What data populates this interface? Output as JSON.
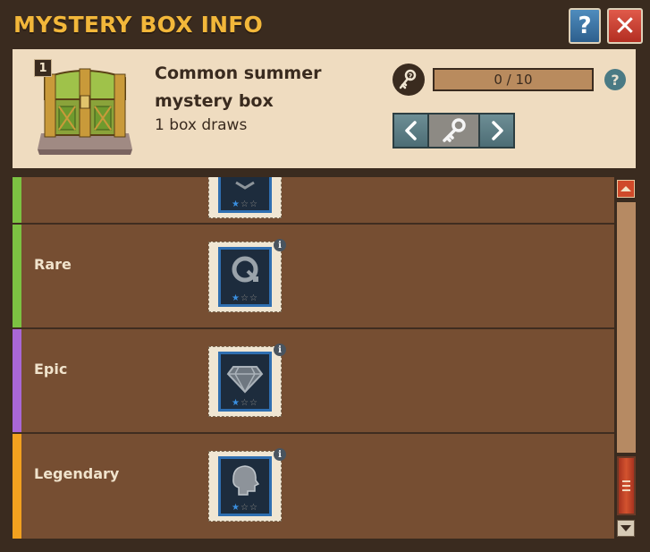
{
  "window": {
    "title": "MYSTERY BOX INFO",
    "help_label": "?",
    "close_label": "✕"
  },
  "box": {
    "tier": "1",
    "name": "Common summer mystery box",
    "draws": "1 box draws",
    "progress": {
      "text": "0 / 10",
      "current": 0,
      "max": 10
    },
    "progress_help_label": "?"
  },
  "rows": [
    {
      "label": "",
      "color": "#7cc242",
      "icon": "partial-icon"
    },
    {
      "label": "Rare",
      "color": "#7cc242",
      "icon": "ring-arrow-icon"
    },
    {
      "label": "Epic",
      "color": "#a967d6",
      "icon": "diamond-icon"
    },
    {
      "label": "Legendary",
      "color": "#f2a11f",
      "icon": "head-profile-icon"
    }
  ],
  "colors": {
    "title": "#f2b73a",
    "panel": "#efdcc0",
    "list_bg": "#764e32",
    "star_on": "#3a8fe0"
  }
}
